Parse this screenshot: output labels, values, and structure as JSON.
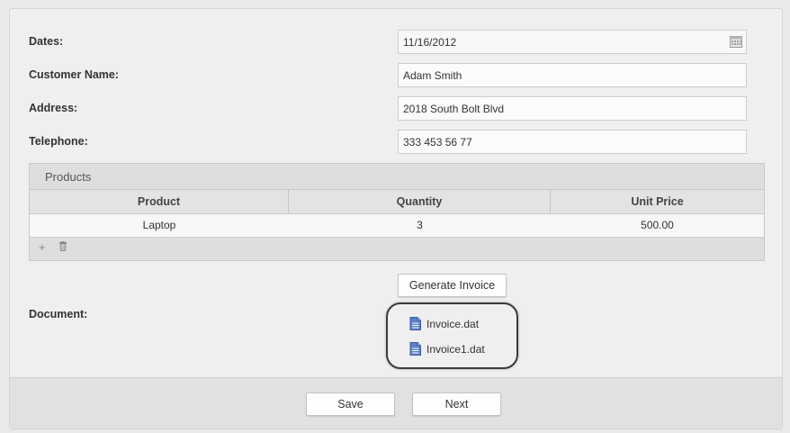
{
  "form": {
    "dates": {
      "label": "Dates:",
      "value": "11/16/2012"
    },
    "customer_name": {
      "label": "Customer Name:",
      "value": "Adam Smith"
    },
    "address": {
      "label": "Address:",
      "value": "2018 South Bolt Blvd"
    },
    "telephone": {
      "label": "Telephone:",
      "value": "333 453 56 77"
    }
  },
  "products": {
    "title": "Products",
    "columns": [
      "Product",
      "Quantity",
      "Unit Price"
    ],
    "rows": [
      [
        "Laptop",
        "3",
        "500.00"
      ]
    ],
    "tools": {
      "add": "+",
      "delete": "🗑"
    }
  },
  "document": {
    "label": "Document:",
    "generate_label": "Generate Invoice",
    "files": [
      "Invoice.dat",
      "Invoice1.dat"
    ]
  },
  "footer": {
    "save_label": "Save",
    "next_label": "Next"
  },
  "colors": {
    "panel_bg": "#efefef",
    "footer_bg": "#e1e1e1",
    "doc_icon": "#4a6fb8",
    "highlight_border": "#3a3a3a"
  },
  "icons": {
    "calendar": "calendar-icon",
    "document": "document-icon"
  }
}
